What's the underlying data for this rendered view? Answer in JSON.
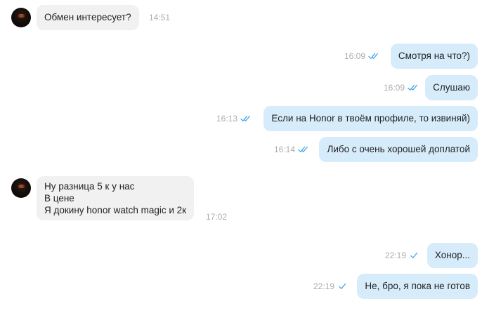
{
  "messages": [
    {
      "dir": "in",
      "text": "Обмен интересует?",
      "time": "14:51"
    },
    {
      "dir": "out",
      "text": "Смотря на что?)",
      "time": "16:09",
      "status": "read"
    },
    {
      "dir": "out",
      "text": "Слушаю",
      "time": "16:09",
      "status": "read"
    },
    {
      "dir": "out",
      "text": "Если на Honor в твоём профиле, то извиняй)",
      "time": "16:13",
      "status": "read"
    },
    {
      "dir": "out",
      "text": "Либо с очень хорошей доплатой",
      "time": "16:14",
      "status": "read"
    },
    {
      "dir": "in",
      "lines": [
        "Ну разница 5 к у нас",
        "В цене",
        "Я докину honor watch magic и 2к"
      ],
      "time": "17:02"
    },
    {
      "dir": "out",
      "text": "Хонор...",
      "time": "22:19",
      "status": "sent"
    },
    {
      "dir": "out",
      "text": "Не, бро, я пока не готов",
      "time": "22:19",
      "status": "sent"
    }
  ],
  "colors": {
    "incoming_bubble": "#f1f1f2",
    "outgoing_bubble": "#d7ecfb",
    "timestamp": "#a9adb2",
    "check": "#3ea9e9"
  },
  "icons": {
    "read": "double-check-icon",
    "sent": "single-check-icon"
  }
}
